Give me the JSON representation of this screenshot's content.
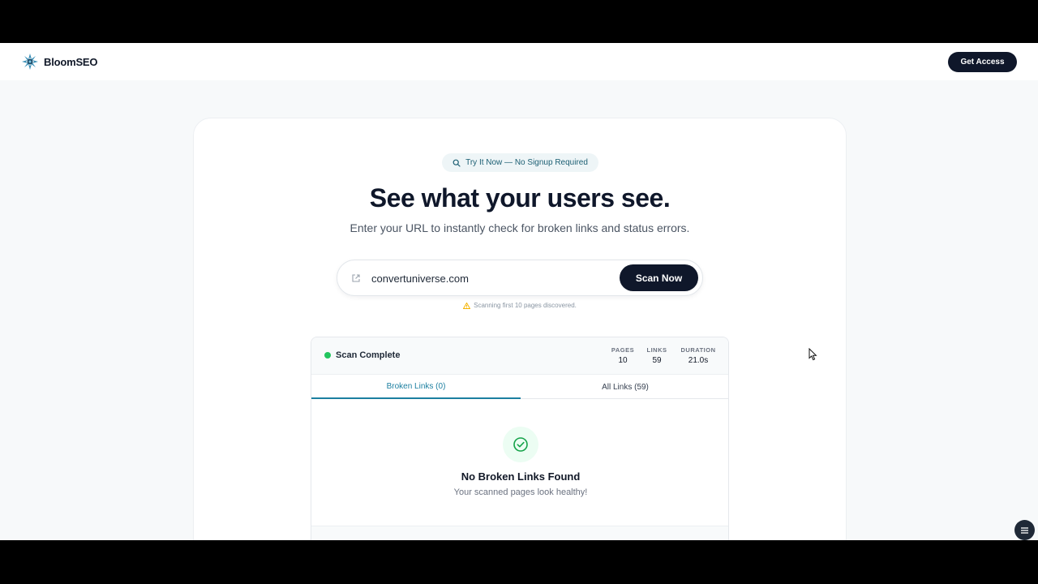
{
  "nav": {
    "brand_name": "BloomSEO",
    "cta_label": "Get Access"
  },
  "hero": {
    "pill_label": "Try It Now — No Signup Required",
    "headline": "See what your users see.",
    "subheadline": "Enter your URL to instantly check for broken links and status errors."
  },
  "scan": {
    "url_value": "convertuniverse.com",
    "button_label": "Scan Now",
    "note": "Scanning first 10 pages discovered."
  },
  "results": {
    "status_label": "Scan Complete",
    "stats": [
      {
        "label": "PAGES",
        "value": "10"
      },
      {
        "label": "LINKS",
        "value": "59"
      },
      {
        "label": "DURATION",
        "value": "21.0s"
      }
    ],
    "tabs": [
      {
        "label": "Broken Links (0)",
        "active": true
      },
      {
        "label": "All Links (59)",
        "active": false
      }
    ],
    "empty_title": "No Broken Links Found",
    "empty_subtitle": "Your scanned pages look healthy!"
  },
  "icons": {
    "brand": "flower-logo-icon",
    "pill": "search-icon",
    "url_field": "external-link-icon",
    "note": "warning-icon",
    "empty_state": "check-circle-icon",
    "fab": "menu-icon"
  },
  "colors": {
    "primary_dark": "#0f172a",
    "accent_teal": "#1c7fa0",
    "success_green": "#22c55e",
    "warning_amber": "#f5b301"
  }
}
